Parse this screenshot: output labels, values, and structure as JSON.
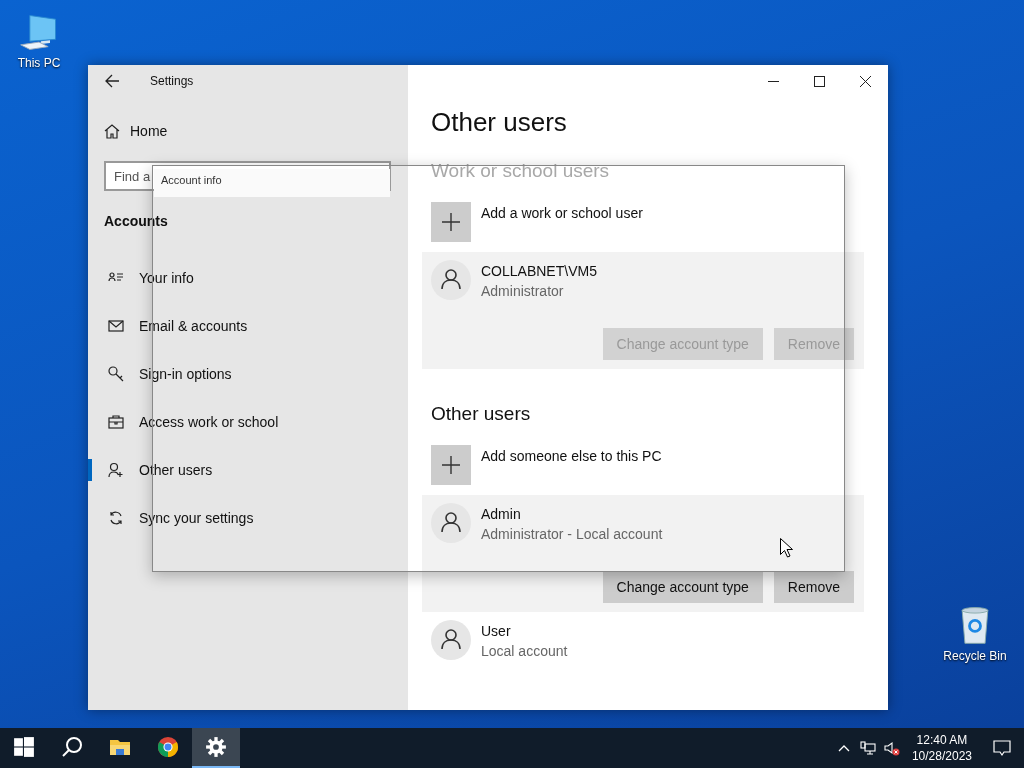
{
  "desktop_icons": [
    {
      "label": "This PC",
      "kind": "computer"
    },
    {
      "label": "Recycle Bin",
      "kind": "recycle"
    }
  ],
  "window": {
    "title": "Settings",
    "home": "Home",
    "search": {
      "placeholder": "Find a"
    },
    "group_label": "Accounts",
    "nav_items": [
      {
        "label": "Your info",
        "kind": "info",
        "selected": false
      },
      {
        "label": "Email & accounts",
        "kind": "mail",
        "selected": false
      },
      {
        "label": "Sign-in options",
        "kind": "key",
        "selected": false
      },
      {
        "label": "Access work or school",
        "kind": "briefcase",
        "selected": false
      },
      {
        "label": "Other users",
        "kind": "people",
        "selected": true
      },
      {
        "label": "Sync your settings",
        "kind": "sync",
        "selected": false
      }
    ],
    "page_title": "Other users",
    "sections": [
      {
        "heading": "Work or school users",
        "dimmed": true,
        "add_label": "Add a work or school user",
        "users": [
          {
            "name": "COLLABNET\\VM5",
            "role": "Administrator",
            "expanded": true,
            "buttons": [
              {
                "label": "Change account type",
                "disabled": true
              },
              {
                "label": "Remove",
                "disabled": true
              }
            ]
          }
        ]
      },
      {
        "heading": "Other users",
        "dimmed": false,
        "add_label": "Add someone else to this PC",
        "users": [
          {
            "name": "Admin",
            "role": "Administrator - Local account",
            "expanded": true,
            "buttons": [
              {
                "label": "Change account type",
                "disabled": false
              },
              {
                "label": "Remove",
                "disabled": false
              }
            ]
          },
          {
            "name": "User",
            "role": "Local account",
            "expanded": false
          }
        ]
      }
    ]
  },
  "dialog": {
    "title": "Account info"
  },
  "taskbar": {
    "apps": [
      {
        "kind": "start",
        "selected": false
      },
      {
        "kind": "search",
        "selected": false
      },
      {
        "kind": "folder",
        "selected": false
      },
      {
        "kind": "browser",
        "selected": false
      },
      {
        "kind": "settings",
        "selected": true
      }
    ],
    "time": "12:40 AM",
    "date": "10/28/2023"
  }
}
